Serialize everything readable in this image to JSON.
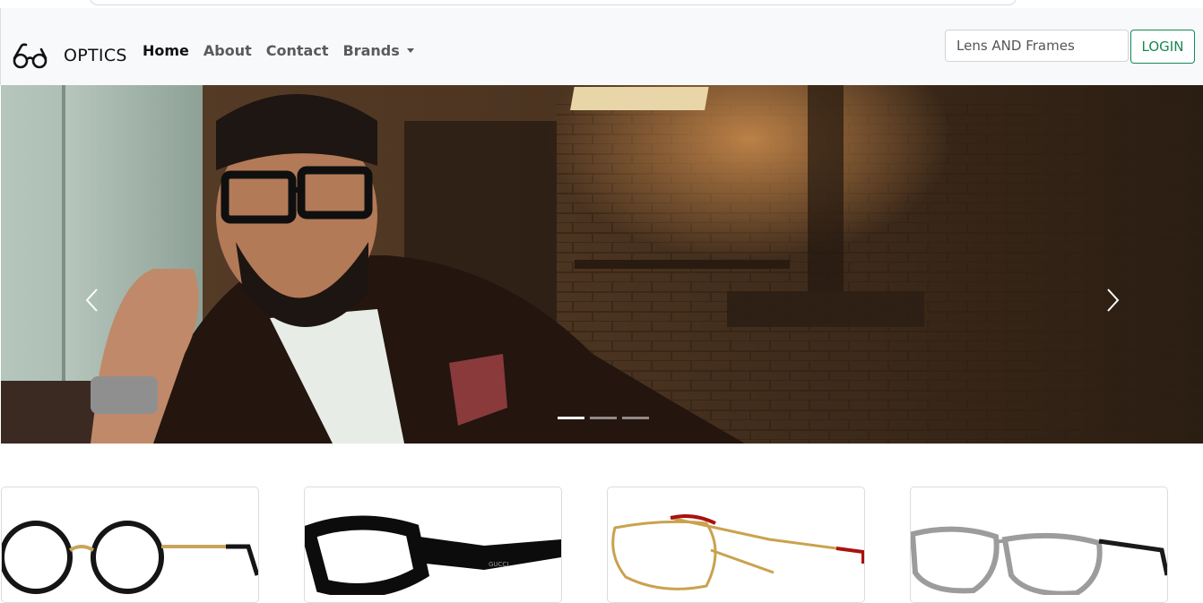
{
  "navbar": {
    "brand_name": "OPTICS",
    "brand_icon": "glasses-icon",
    "links": [
      "Home",
      "About",
      "Contact",
      "Brands"
    ],
    "active_link": "Home",
    "search": {
      "placeholder": "Lens AND Frames",
      "value": ""
    },
    "login_label": "LOGIN"
  },
  "carousel": {
    "slide_count": 3,
    "active_slide": 1,
    "prev_icon": "chevron-left-icon",
    "next_icon": "chevron-right-icon"
  },
  "products": [
    {
      "image": "round-black-gold-glasses"
    },
    {
      "image": "thick-black-square-glasses"
    },
    {
      "image": "gold-aviator-glasses"
    },
    {
      "image": "clear-round-glasses"
    }
  ],
  "colors": {
    "navbar_bg": "#f8f9fa",
    "login_accent": "#198754"
  }
}
